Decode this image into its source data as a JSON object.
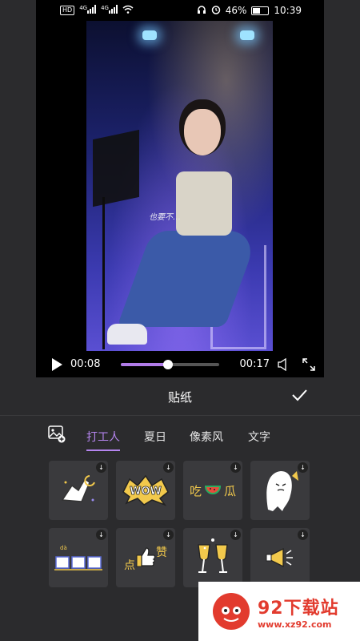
{
  "status_bar": {
    "sim_label": "HD",
    "net_left": "4G",
    "net_right": "4G",
    "battery": "46%",
    "time": "10:39",
    "icons": [
      "headphones-icon",
      "alarm-icon",
      "battery-icon"
    ]
  },
  "video": {
    "lyric": "也要不…",
    "current_time": "00:08",
    "total_time": "00:17",
    "progress": 0.48
  },
  "panel": {
    "title": "贴纸",
    "confirm_icon": "check-icon"
  },
  "tabs": [
    {
      "label": "打工人",
      "active": true
    },
    {
      "label": "夏日",
      "active": false
    },
    {
      "label": "像素风",
      "active": false
    },
    {
      "label": "文字",
      "active": false
    }
  ],
  "stickers": [
    {
      "icon": "hand-moon-sticker"
    },
    {
      "icon": "wow-sticker"
    },
    {
      "icon": "watermelon-sticker",
      "text_a": "吃",
      "text_b": "瓜"
    },
    {
      "icon": "ghost-flag-sticker"
    },
    {
      "icon": "blank-boxes-sticker",
      "text_a": "dà"
    },
    {
      "icon": "thumbs-up-sticker",
      "text_a": "点",
      "text_b": "赞"
    },
    {
      "icon": "cheers-sticker"
    },
    {
      "icon": "megaphone-sticker"
    }
  ],
  "watermark": {
    "title": "92下载站",
    "url": "www.xz92.com"
  },
  "colors": {
    "accent": "#b585ef",
    "panel_bg": "#2b2b2d",
    "tile_bg": "#3a3a3d"
  }
}
